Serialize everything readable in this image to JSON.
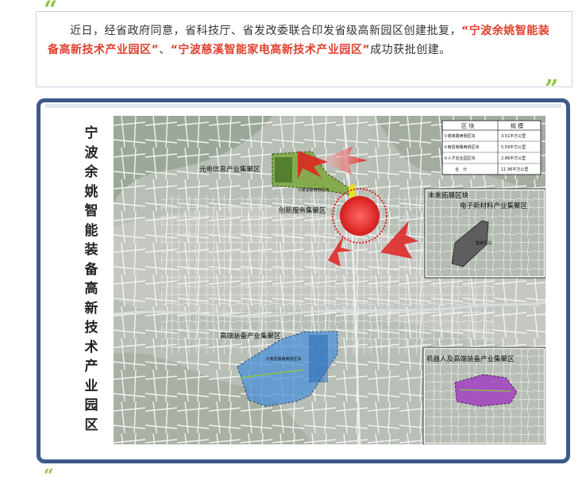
{
  "intro": {
    "part1": "近日，经省政府同意，省科技厅、省发改委联合印发省级高新园区创建批复，",
    "hl1": "“宁波余姚智能装备高新技术产业园区”",
    "sep": "、",
    "hl2": "“宁波慈溪智能家电高新技术产业园区”",
    "part2": "成功获批创建。"
  },
  "quote_open": "“",
  "quote_close": "”",
  "map": {
    "vertical_title": [
      "宁",
      "波",
      "余",
      "姚",
      "智",
      "能",
      "装",
      "备",
      "高",
      "新",
      "技",
      "术",
      "产",
      "业",
      "园",
      "区"
    ],
    "labels": {
      "optoelectronics": "光电信息产业集聚区",
      "innovation": "创新服务集聚区",
      "future_block": "未来拓展区块",
      "new_materials": "电子新材料产业集聚区",
      "high_end": "高端装备产业集聚区",
      "robot": "机器人及高端装备产业集聚区",
      "small_road1": "①谢家路两侧区块",
      "small_road2": "②南雷南路两侧区块",
      "small_road3": "集聚区块"
    },
    "table": {
      "headers": [
        "区 块",
        "规 模"
      ],
      "rows": [
        [
          "①谢家路两侧区块",
          "3.51平方公里"
        ],
        [
          "②南雷南路两侧区块",
          "5.59平方公里"
        ],
        [
          "③人才创业园区块",
          "2.86平方公里"
        ],
        [
          "合　计",
          "11.96平方公里"
        ]
      ]
    }
  },
  "colors": {
    "accent": "#e0412e",
    "quote": "#8dc63f",
    "frame": "#3d5a8a"
  }
}
